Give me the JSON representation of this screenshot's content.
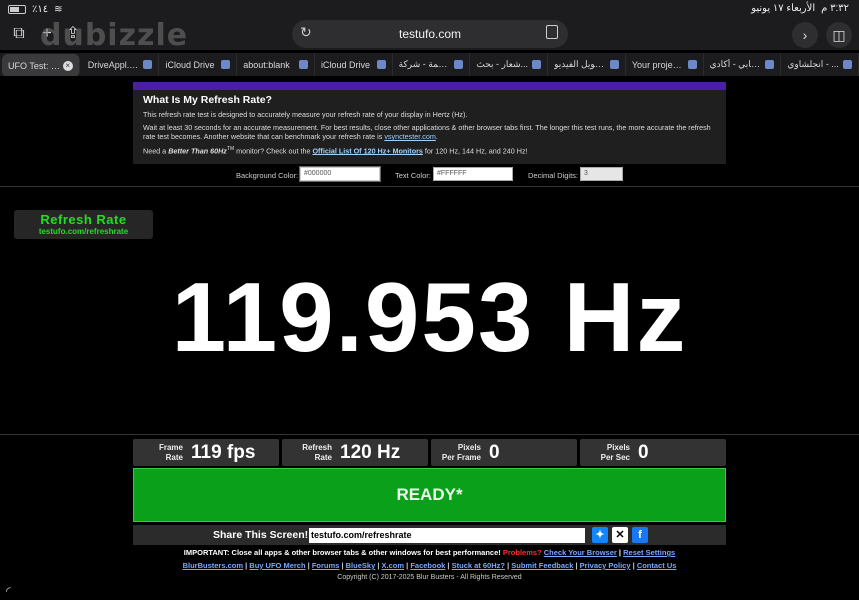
{
  "status": {
    "time": "٣:٣٢ م",
    "date": "الأربعاء ١٧ يونيو",
    "signal": "٪١٤"
  },
  "toolbar": {
    "watermark": "dubizzle",
    "url": "testufo.com"
  },
  "tabs": [
    {
      "label": "UFO Test: R...",
      "active": true
    },
    {
      "label": "DriveAppl... -",
      "active": false
    },
    {
      "label": "iCloud Drive",
      "active": false
    },
    {
      "label": "about:blank",
      "active": false
    },
    {
      "label": "iCloud Drive",
      "active": false
    },
    {
      "label": "بصمة - شركة...",
      "active": false
    },
    {
      "label": "شعار - بحث...",
      "active": false
    },
    {
      "label": "تحويل الفيديو...",
      "active": false
    },
    {
      "label": "Your projec...",
      "active": false
    },
    {
      "label": "حسابي - أكادي...",
      "active": false
    },
    {
      "label": "انجلشاوي - ...",
      "active": false
    }
  ],
  "info": {
    "title": "What Is My Refresh Rate?",
    "p1": "This refresh rate test is designed to accurately measure your refresh rate of your display in Hertz (Hz).",
    "p2a": "Wait at least 30 seconds for an accurate measurement. For best results, close other applications & other browser tabs first. The longer this test runs, the more accurate the refresh rate test becomes. Another website that can benchmark your refresh rate is ",
    "p2link": "vsynctester.com",
    "p2b": ".",
    "p3a": "Need a ",
    "p3bold": "Better Than 60Hz",
    "p3tm": "TM",
    "p3b": " monitor? Check out the ",
    "p3link": "Official List Of 120 Hz+ Monitors",
    "p3c": " for 120 Hz, 144 Hz, and 240 Hz!"
  },
  "settings": {
    "bg_label": "Background Color:",
    "bg_value": "#000000",
    "text_label": "Text Color:",
    "text_value": "#FFFFFF",
    "digits_label": "Decimal Digits:",
    "digits_value": "3"
  },
  "badge": {
    "title": "Refresh Rate",
    "url": "testufo.com/refreshrate"
  },
  "measurement": {
    "value": "119.953 Hz"
  },
  "stats": {
    "frame_rate_label1": "Frame",
    "frame_rate_label2": "Rate",
    "frame_rate_value": "119 fps",
    "refresh_label1": "Refresh",
    "refresh_label2": "Rate",
    "refresh_value": "120 Hz",
    "ppf_label1": "Pixels",
    "ppf_label2": "Per Frame",
    "ppf_value": "0",
    "pps_label1": "Pixels",
    "pps_label2": "Per Sec",
    "pps_value": "0"
  },
  "ready": {
    "label": "READY*"
  },
  "share": {
    "label": "Share This Screen!",
    "url": "testufo.com/refreshrate"
  },
  "footer": {
    "important": "IMPORTANT: Close all apps & other browser tabs & other windows for best performance!",
    "problems": "Problems?",
    "check_browser": "Check Your Browser",
    "reset": "Reset Settings",
    "links": [
      "BlurBusters.com",
      "Buy UFO Merch",
      "Forums",
      "BlueSky",
      "X.com",
      "Facebook",
      "Stuck at 60Hz?",
      "Submit Feedback",
      "Privacy Policy",
      "Contact Us"
    ],
    "copyright": "Copyright (C) 2017-2025 Blur Busters - All Rights Reserved"
  },
  "colors": {
    "green_text": "#22dd22",
    "ready_bg": "#0aa01a",
    "purple": "#4a1fa8",
    "link": "#7aa8ff"
  }
}
